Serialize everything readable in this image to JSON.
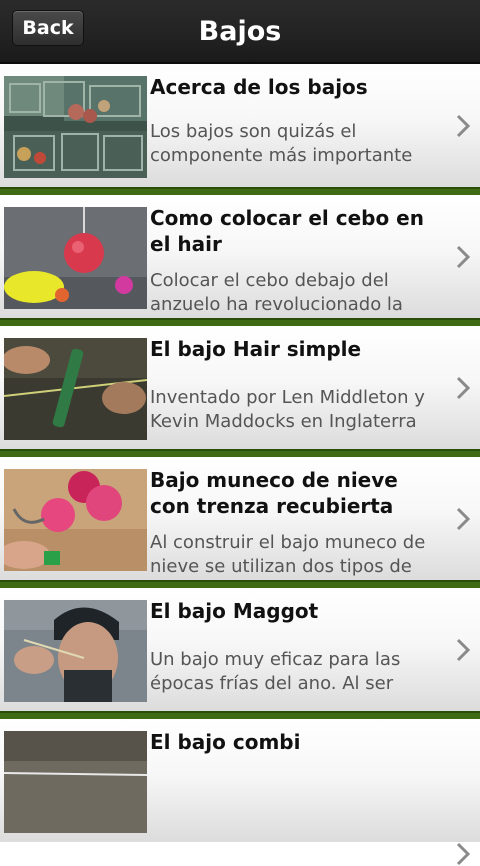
{
  "header": {
    "back_label": "Back",
    "title": "Bajos"
  },
  "items": [
    {
      "title": "Acerca de los bajos",
      "desc": "Los bajos son quizás el componente más importante",
      "image": "carp-tackle-box-image"
    },
    {
      "title": "Como colocar el cebo en el hair",
      "desc": "Colocar el cebo debajo del anzuelo ha revolucionado la",
      "image": "boilie-bait-image"
    },
    {
      "title": "El bajo Hair simple",
      "desc": "Inventado por Len Middleton y Kevin Maddocks en Inglaterra",
      "image": "baiting-needle-image"
    },
    {
      "title": "Bajo muneco de nieve con trenza recubierta",
      "desc": "Al construir el bajo muneco de nieve se utilizan dos tipos de",
      "image": "snowman-rig-image"
    },
    {
      "title": "El bajo Maggot",
      "desc": "Un bajo muy eficaz para las épocas frías del ano. Al ser",
      "image": "angler-maggot-image"
    },
    {
      "title": "El bajo combi",
      "desc": "",
      "image": "combi-rig-image"
    }
  ],
  "colors": {
    "separator": "#3d6a12",
    "header_bg": "#232323"
  }
}
